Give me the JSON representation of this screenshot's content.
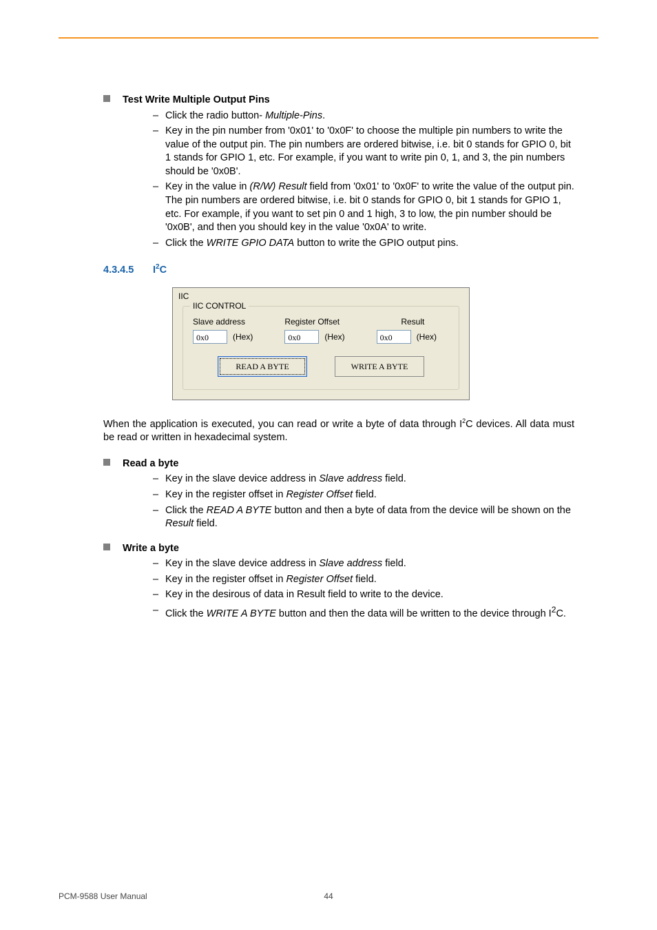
{
  "section1": {
    "title": "Test Write Multiple Output Pins",
    "items": [
      {
        "pre": "Click the radio button- ",
        "ital": "Multiple-Pins",
        "post": "."
      },
      {
        "text": "Key in the pin number from '0x01' to '0x0F' to choose the multiple pin numbers to write the value of the output pin. The pin numbers are ordered bitwise, i.e. bit 0 stands for GPIO 0, bit 1 stands for GPIO 1, etc. For example, if you want to write pin 0, 1, and 3, the pin numbers should be '0x0B'."
      },
      {
        "pre": "Key in the value in ",
        "ital": "(R/W) Result",
        "post": " field from '0x01' to '0x0F' to write the value of the output pin. The pin numbers are ordered bitwise, i.e. bit 0 stands for GPIO 0, bit 1 stands for GPIO 1, etc. For example, if you want to set pin 0 and 1 high, 3 to low, the pin number should be '0x0B', and then you should key in the value '0x0A' to write."
      },
      {
        "pre": "Click the ",
        "ital": "WRITE GPIO DATA",
        "post": " button to write the GPIO output pins."
      }
    ]
  },
  "heading": {
    "num": "4.3.4.5",
    "title_prefix": "I",
    "title_sup": "2",
    "title_suffix": "C"
  },
  "screenshot": {
    "panel_title": "IIC",
    "group_title": "IIC CONTROL",
    "cols": [
      {
        "label": "Slave address",
        "value": "0x0",
        "unit": "(Hex)"
      },
      {
        "label": "Register Offset",
        "value": "0x0",
        "unit": "(Hex)"
      },
      {
        "label": "Result",
        "value": "0x0",
        "unit": "(Hex)"
      }
    ],
    "btn_read": "READ A BYTE",
    "btn_write": "WRITE A BYTE"
  },
  "para1": {
    "pre": "When the application is executed, you can read or write a byte of data through I",
    "sup": "2",
    "post": "C devices. All data must be read or written in hexadecimal system."
  },
  "readbyte": {
    "title": "Read a byte",
    "items": [
      {
        "pre": "Key in the slave device address in ",
        "ital": "Slave address",
        "post": " field."
      },
      {
        "pre": "Key in the register offset in ",
        "ital": "Register Offset",
        "post": " field."
      },
      {
        "pre": "Click the ",
        "ital": "READ A BYTE",
        "mid": " button and then a byte of data from the device will be shown on the ",
        "ital2": "Result",
        "post": " field."
      }
    ]
  },
  "writebyte": {
    "title": "Write a byte",
    "items": [
      {
        "pre": "Key in the slave device address in ",
        "ital": "Slave address",
        "post": " field."
      },
      {
        "pre": "Key in the register offset in ",
        "ital": "Register Offset",
        "post": " field."
      },
      {
        "text": "Key in the desirous of data in Result field to write to the device."
      },
      {
        "pre": "Click the ",
        "ital": "WRITE A BYTE",
        "mid": " button and then the data will be written to the device through I",
        "sup": "2",
        "post": "C."
      }
    ]
  },
  "footer": {
    "left": "PCM-9588 User Manual",
    "center": "44"
  }
}
